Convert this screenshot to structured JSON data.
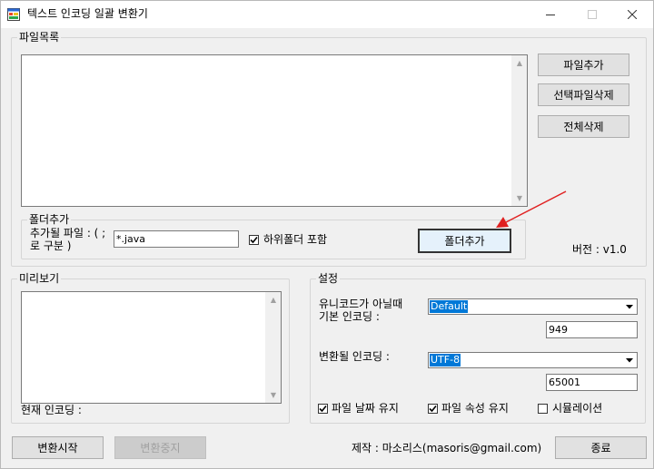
{
  "window": {
    "title": "텍스트 인코딩 일괄 변환기",
    "icon": "app-window-icon",
    "controls": {
      "minimize": "—",
      "maximize": "☐",
      "close": "✕"
    }
  },
  "file_list": {
    "group_title": "파일목록",
    "add_file": "파일추가",
    "delete_selected": "선택파일삭제",
    "delete_all": "전체삭제",
    "version": "버전 : v1.0"
  },
  "folder_add": {
    "group_title": "폴더추가",
    "files_label": "추가될 파일 : ( ;\n로 구분 )",
    "files_label_line1": "추가될 파일 : ( ;",
    "files_label_line2": "로 구분 )",
    "files_value": "*.java",
    "include_subfolders_label": "하위폴더 포함",
    "include_subfolders_checked": true,
    "add_folder_button": "폴더추가"
  },
  "preview": {
    "group_title": "미리보기",
    "current_encoding_label": "현재 인코딩 :"
  },
  "settings": {
    "group_title": "설정",
    "default_encoding_label_line1": "유니코드가 아닐때",
    "default_encoding_label_line2": "기본 인코딩 :",
    "default_encoding_value": "Default",
    "default_codepage": "949",
    "target_encoding_label": "변환될 인코딩 :",
    "target_encoding_value": "UTF-8",
    "target_codepage": "65001",
    "keep_file_date_label": "파일 날짜 유지",
    "keep_file_date_checked": true,
    "keep_file_attr_label": "파일 속성 유지",
    "keep_file_attr_checked": true,
    "simulation_label": "시뮬레이션",
    "simulation_checked": false
  },
  "footer": {
    "start": "변환시작",
    "stop": "변환중지",
    "credit": "제작 : 마소리스(masoris@gmail.com)",
    "exit": "종료"
  },
  "colors": {
    "annotation_arrow": "#e02020",
    "selection": "#0078d7"
  }
}
